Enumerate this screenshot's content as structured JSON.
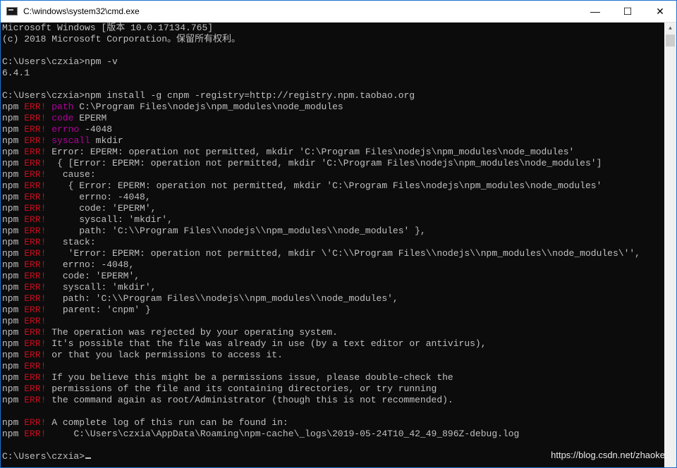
{
  "window": {
    "title": "C:\\windows\\system32\\cmd.exe",
    "minimize_glyph": "—",
    "maximize_glyph": "☐",
    "close_glyph": "✕"
  },
  "console": {
    "lines": [
      {
        "segments": [
          {
            "text": "Microsoft Windows [版本 10.0.17134.765]",
            "style": "normal"
          }
        ]
      },
      {
        "segments": [
          {
            "text": "(c) 2018 Microsoft Corporation。保留所有权利。",
            "style": "normal"
          }
        ]
      },
      {
        "segments": [
          {
            "text": "",
            "style": "normal"
          }
        ]
      },
      {
        "segments": [
          {
            "text": "C:\\Users\\czxia>npm -v",
            "style": "normal"
          }
        ]
      },
      {
        "segments": [
          {
            "text": "6.4.1",
            "style": "normal"
          }
        ]
      },
      {
        "segments": [
          {
            "text": "",
            "style": "normal"
          }
        ]
      },
      {
        "segments": [
          {
            "text": "C:\\Users\\czxia>npm install -g cnpm -registry=http://registry.npm.taobao.org",
            "style": "normal"
          }
        ]
      },
      {
        "segments": [
          {
            "text": "npm ",
            "style": "normal"
          },
          {
            "text": "ERR!",
            "style": "err"
          },
          {
            "text": " ",
            "style": "normal"
          },
          {
            "text": "path",
            "style": "mag"
          },
          {
            "text": " C:\\Program Files\\nodejs\\npm_modules\\node_modules",
            "style": "normal"
          }
        ]
      },
      {
        "segments": [
          {
            "text": "npm ",
            "style": "normal"
          },
          {
            "text": "ERR!",
            "style": "err"
          },
          {
            "text": " ",
            "style": "normal"
          },
          {
            "text": "code",
            "style": "mag"
          },
          {
            "text": " EPERM",
            "style": "normal"
          }
        ]
      },
      {
        "segments": [
          {
            "text": "npm ",
            "style": "normal"
          },
          {
            "text": "ERR!",
            "style": "err"
          },
          {
            "text": " ",
            "style": "normal"
          },
          {
            "text": "errno",
            "style": "mag"
          },
          {
            "text": " -4048",
            "style": "normal"
          }
        ]
      },
      {
        "segments": [
          {
            "text": "npm ",
            "style": "normal"
          },
          {
            "text": "ERR!",
            "style": "err"
          },
          {
            "text": " ",
            "style": "normal"
          },
          {
            "text": "syscall",
            "style": "mag"
          },
          {
            "text": " mkdir",
            "style": "normal"
          }
        ]
      },
      {
        "segments": [
          {
            "text": "npm ",
            "style": "normal"
          },
          {
            "text": "ERR!",
            "style": "err"
          },
          {
            "text": " Error: EPERM: operation not permitted, mkdir 'C:\\Program Files\\nodejs\\npm_modules\\node_modules'",
            "style": "normal"
          }
        ]
      },
      {
        "segments": [
          {
            "text": "npm ",
            "style": "normal"
          },
          {
            "text": "ERR!",
            "style": "err"
          },
          {
            "text": "  { [Error: EPERM: operation not permitted, mkdir 'C:\\Program Files\\nodejs\\npm_modules\\node_modules']",
            "style": "normal"
          }
        ]
      },
      {
        "segments": [
          {
            "text": "npm ",
            "style": "normal"
          },
          {
            "text": "ERR!",
            "style": "err"
          },
          {
            "text": "   cause:",
            "style": "normal"
          }
        ]
      },
      {
        "segments": [
          {
            "text": "npm ",
            "style": "normal"
          },
          {
            "text": "ERR!",
            "style": "err"
          },
          {
            "text": "    { Error: EPERM: operation not permitted, mkdir 'C:\\Program Files\\nodejs\\npm_modules\\node_modules'",
            "style": "normal"
          }
        ]
      },
      {
        "segments": [
          {
            "text": "npm ",
            "style": "normal"
          },
          {
            "text": "ERR!",
            "style": "err"
          },
          {
            "text": "      errno: -4048,",
            "style": "normal"
          }
        ]
      },
      {
        "segments": [
          {
            "text": "npm ",
            "style": "normal"
          },
          {
            "text": "ERR!",
            "style": "err"
          },
          {
            "text": "      code: 'EPERM',",
            "style": "normal"
          }
        ]
      },
      {
        "segments": [
          {
            "text": "npm ",
            "style": "normal"
          },
          {
            "text": "ERR!",
            "style": "err"
          },
          {
            "text": "      syscall: 'mkdir',",
            "style": "normal"
          }
        ]
      },
      {
        "segments": [
          {
            "text": "npm ",
            "style": "normal"
          },
          {
            "text": "ERR!",
            "style": "err"
          },
          {
            "text": "      path: 'C:\\\\Program Files\\\\nodejs\\\\npm_modules\\\\node_modules' },",
            "style": "normal"
          }
        ]
      },
      {
        "segments": [
          {
            "text": "npm ",
            "style": "normal"
          },
          {
            "text": "ERR!",
            "style": "err"
          },
          {
            "text": "   stack:",
            "style": "normal"
          }
        ]
      },
      {
        "segments": [
          {
            "text": "npm ",
            "style": "normal"
          },
          {
            "text": "ERR!",
            "style": "err"
          },
          {
            "text": "    'Error: EPERM: operation not permitted, mkdir \\'C:\\\\Program Files\\\\nodejs\\\\npm_modules\\\\node_modules\\'',",
            "style": "normal"
          }
        ]
      },
      {
        "segments": [
          {
            "text": "npm ",
            "style": "normal"
          },
          {
            "text": "ERR!",
            "style": "err"
          },
          {
            "text": "   errno: -4048,",
            "style": "normal"
          }
        ]
      },
      {
        "segments": [
          {
            "text": "npm ",
            "style": "normal"
          },
          {
            "text": "ERR!",
            "style": "err"
          },
          {
            "text": "   code: 'EPERM',",
            "style": "normal"
          }
        ]
      },
      {
        "segments": [
          {
            "text": "npm ",
            "style": "normal"
          },
          {
            "text": "ERR!",
            "style": "err"
          },
          {
            "text": "   syscall: 'mkdir',",
            "style": "normal"
          }
        ]
      },
      {
        "segments": [
          {
            "text": "npm ",
            "style": "normal"
          },
          {
            "text": "ERR!",
            "style": "err"
          },
          {
            "text": "   path: 'C:\\\\Program Files\\\\nodejs\\\\npm_modules\\\\node_modules',",
            "style": "normal"
          }
        ]
      },
      {
        "segments": [
          {
            "text": "npm ",
            "style": "normal"
          },
          {
            "text": "ERR!",
            "style": "err"
          },
          {
            "text": "   parent: 'cnpm' }",
            "style": "normal"
          }
        ]
      },
      {
        "segments": [
          {
            "text": "npm ",
            "style": "normal"
          },
          {
            "text": "ERR!",
            "style": "err"
          }
        ]
      },
      {
        "segments": [
          {
            "text": "npm ",
            "style": "normal"
          },
          {
            "text": "ERR!",
            "style": "err"
          },
          {
            "text": " The operation was rejected by your operating system.",
            "style": "normal"
          }
        ]
      },
      {
        "segments": [
          {
            "text": "npm ",
            "style": "normal"
          },
          {
            "text": "ERR!",
            "style": "err"
          },
          {
            "text": " It's possible that the file was already in use (by a text editor or antivirus),",
            "style": "normal"
          }
        ]
      },
      {
        "segments": [
          {
            "text": "npm ",
            "style": "normal"
          },
          {
            "text": "ERR!",
            "style": "err"
          },
          {
            "text": " or that you lack permissions to access it.",
            "style": "normal"
          }
        ]
      },
      {
        "segments": [
          {
            "text": "npm ",
            "style": "normal"
          },
          {
            "text": "ERR!",
            "style": "err"
          }
        ]
      },
      {
        "segments": [
          {
            "text": "npm ",
            "style": "normal"
          },
          {
            "text": "ERR!",
            "style": "err"
          },
          {
            "text": " If you believe this might be a permissions issue, please double-check the",
            "style": "normal"
          }
        ]
      },
      {
        "segments": [
          {
            "text": "npm ",
            "style": "normal"
          },
          {
            "text": "ERR!",
            "style": "err"
          },
          {
            "text": " permissions of the file and its containing directories, or try running",
            "style": "normal"
          }
        ]
      },
      {
        "segments": [
          {
            "text": "npm ",
            "style": "normal"
          },
          {
            "text": "ERR!",
            "style": "err"
          },
          {
            "text": " the command again as root/Administrator (though this is not recommended).",
            "style": "normal"
          }
        ]
      },
      {
        "segments": [
          {
            "text": "",
            "style": "normal"
          }
        ]
      },
      {
        "segments": [
          {
            "text": "npm ",
            "style": "normal"
          },
          {
            "text": "ERR!",
            "style": "err"
          },
          {
            "text": " A complete log of this run can be found in:",
            "style": "normal"
          }
        ]
      },
      {
        "segments": [
          {
            "text": "npm ",
            "style": "normal"
          },
          {
            "text": "ERR!",
            "style": "err"
          },
          {
            "text": "     C:\\Users\\czxia\\AppData\\Roaming\\npm-cache\\_logs\\2019-05-24T10_42_49_896Z-debug.log",
            "style": "normal"
          }
        ]
      },
      {
        "segments": [
          {
            "text": "",
            "style": "normal"
          }
        ]
      },
      {
        "segments": [
          {
            "text": "C:\\Users\\czxia>",
            "style": "normal"
          }
        ],
        "cursor": true
      }
    ]
  },
  "watermark": "https://blog.csdn.net/zhaoke",
  "colors": {
    "background": "#0c0c0c",
    "text": "#c0c0c0",
    "err": "#c50f1f",
    "keyword": "#b4009e",
    "title_border": "#1c6fd1"
  }
}
